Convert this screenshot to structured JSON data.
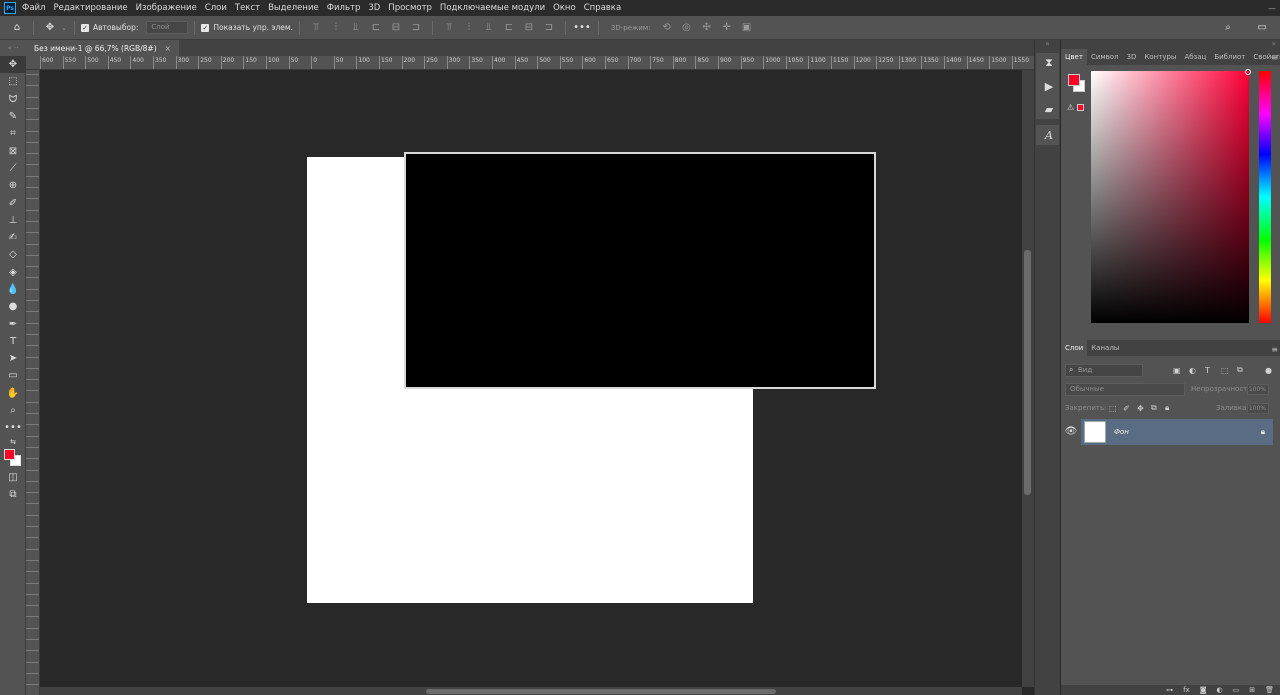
{
  "menubar": {
    "logo": "Ps",
    "items": [
      "Файл",
      "Редактирование",
      "Изображение",
      "Слои",
      "Текст",
      "Выделение",
      "Фильтр",
      "3D",
      "Просмотр",
      "Подключаемые модули",
      "Окно",
      "Справка"
    ]
  },
  "options": {
    "autoselect_label": "Автовыбор:",
    "autoselect_target": "Слой",
    "show_controls_label": "Показать упр. элем.",
    "mode_3d_label": "3D-режим:"
  },
  "document": {
    "tab_title": "Без имени-1 @ 66,7% (RGB/8#)",
    "close": "×"
  },
  "ruler": {
    "top_labels": [
      "600",
      "550",
      "500",
      "450",
      "400",
      "350",
      "300",
      "250",
      "200",
      "150",
      "100",
      "50",
      "0",
      "50",
      "100",
      "150",
      "200",
      "250",
      "300",
      "350",
      "400",
      "450",
      "500",
      "550",
      "600",
      "650",
      "700",
      "750",
      "800",
      "850",
      "900",
      "950",
      "1000",
      "1050",
      "1100",
      "1150",
      "1200",
      "1250",
      "1300",
      "1350",
      "1400",
      "1450",
      "1500",
      "1550"
    ]
  },
  "colors": {
    "foreground": "#ff0026",
    "background": "#ffffff",
    "canvas_doc": "#ffffff",
    "shape_fill": "#000000"
  },
  "color_panel": {
    "tabs": [
      "Цвет",
      "Символ",
      "3D",
      "Контуры",
      "Абзац",
      "Библиот",
      "Свойства"
    ],
    "active_tab": "Цвет"
  },
  "layers_panel": {
    "tabs": [
      "Слои",
      "Каналы"
    ],
    "active_tab": "Слои",
    "filter_placeholder": "Вид",
    "blend_mode": "Обычные",
    "opacity_label": "Непрозрачность:",
    "opacity_value": "100%",
    "lock_label": "Закрепить:",
    "fill_label": "Заливка:",
    "fill_value": "100%",
    "layers": [
      {
        "name": "Фон",
        "visible": true,
        "locked": true
      }
    ]
  }
}
